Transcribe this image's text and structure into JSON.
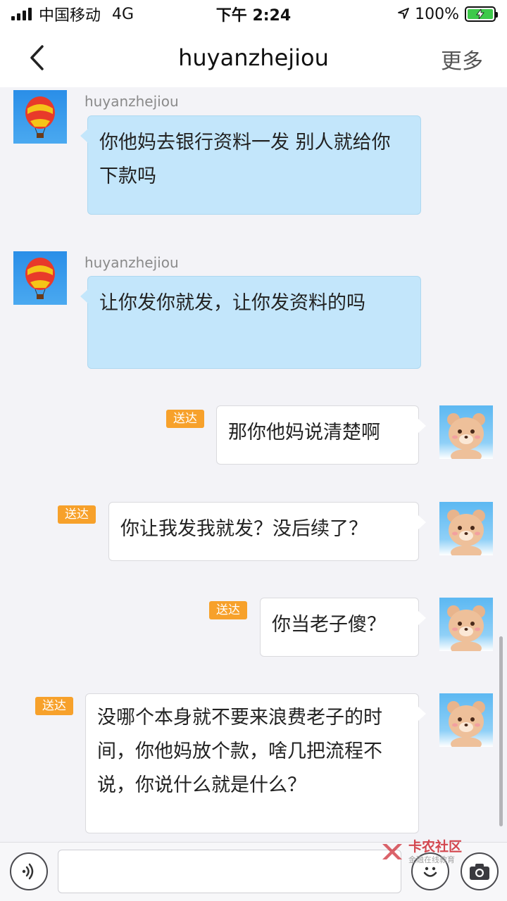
{
  "status_bar": {
    "carrier": "中国移动",
    "network": "4G",
    "time": "下午 2:24",
    "battery": "100%"
  },
  "nav": {
    "title": "huyanzhejiou",
    "more": "更多"
  },
  "messages": [
    {
      "sender": "huyanzhejiou",
      "direction": "incoming",
      "text": "你他妈去银行资料一发 别人就给你下款吗"
    },
    {
      "sender": "huyanzhejiou",
      "direction": "incoming",
      "text": "让你发你就发，让你发资料的吗"
    },
    {
      "direction": "outgoing",
      "status": "送达",
      "text": "那你他妈说清楚啊"
    },
    {
      "direction": "outgoing",
      "status": "送达",
      "text": "你让我发我就发？没后续了？"
    },
    {
      "direction": "outgoing",
      "status": "送达",
      "text": "你当老子傻？"
    },
    {
      "direction": "outgoing",
      "status": "送达",
      "text": "没哪个本身就不要来浪费老子的时间，你他妈放个款，啥几把流程不说，你说什么就是什么？"
    }
  ],
  "input": {
    "value": ""
  },
  "watermark": {
    "main": "卡农社区",
    "sub": "金融在线教育"
  },
  "icons": {
    "back": "chevron-left-icon",
    "voice": "voice-icon",
    "emoji": "emoji-icon",
    "camera": "camera-icon",
    "location": "location-arrow-icon",
    "battery": "battery-charging-icon"
  },
  "colors": {
    "incoming_bubble": "#c3e6fb",
    "outgoing_bubble": "#ffffff",
    "status_badge": "#f7a12b",
    "battery_fill": "#3ec94a"
  }
}
